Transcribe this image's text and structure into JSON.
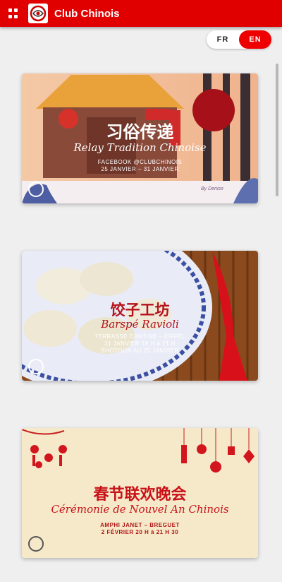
{
  "app": {
    "title": "Club Chinois"
  },
  "language": {
    "fr": "FR",
    "en": "EN",
    "selected": "EN"
  },
  "events": [
    {
      "chinese": "习俗传递",
      "title": "Relay Tradition Chinoise",
      "line1": "FACEBOOK @CLUBCHINOIS",
      "line2": "25 JANVIER – 31 JANVIER",
      "signature": "By Denise"
    },
    {
      "chinese": "饺子工坊",
      "title": "Barspé Ravioli",
      "line1": "TERRASSE CANTINE – EIFFEL",
      "line2": "31 JANVIER 19 H à 21 H",
      "line3": "SHOTGUN AU 25 JANVIER"
    },
    {
      "chinese": "春节联欢晚会",
      "title": "Cérémonie de Nouvel An Chinois",
      "line1": "AMPHI JANET – BREGUET",
      "line2": "2 FÉVRIER 20 H à 21 H 30"
    }
  ],
  "colors": {
    "brand": "#e00000",
    "background": "#efefef"
  }
}
